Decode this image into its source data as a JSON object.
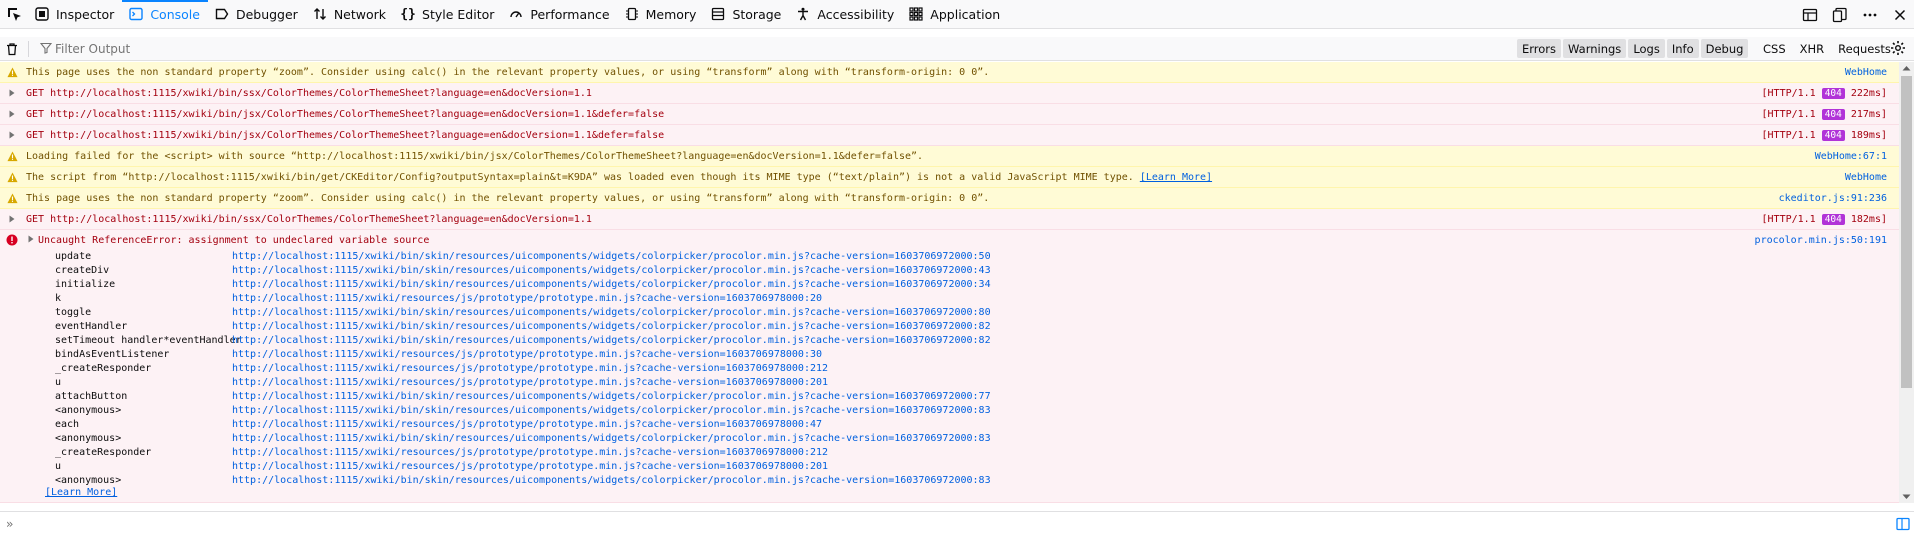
{
  "tabs": [
    {
      "label": "Inspector",
      "icon": "inspector-icon"
    },
    {
      "label": "Console",
      "icon": "console-icon",
      "selected": true
    },
    {
      "label": "Debugger",
      "icon": "debugger-icon"
    },
    {
      "label": "Network",
      "icon": "network-icon"
    },
    {
      "label": "Style Editor",
      "icon": "style-editor-icon"
    },
    {
      "label": "Performance",
      "icon": "performance-icon"
    },
    {
      "label": "Memory",
      "icon": "memory-icon"
    },
    {
      "label": "Storage",
      "icon": "storage-icon"
    },
    {
      "label": "Accessibility",
      "icon": "accessibility-icon"
    },
    {
      "label": "Application",
      "icon": "application-icon"
    }
  ],
  "filter": {
    "placeholder": "Filter Output"
  },
  "levels": [
    "Errors",
    "Warnings",
    "Logs",
    "Info",
    "Debug"
  ],
  "categories": [
    "CSS",
    "XHR",
    "Requests"
  ],
  "colors": {
    "accent": "#0a84ff",
    "warn_bg": "#fffbd6",
    "error_bg": "#fdf2f5",
    "badge": "#b133d8",
    "link": "#0060df"
  },
  "messages": [
    {
      "text": "This page uses the non standard property “zoom”. Consider using calc() in the relevant property values, or using “transform” along with “transform-origin: 0 0”.",
      "source": "WebHome"
    },
    {
      "text": "GET http://localhost:1115/xwiki/bin/ssx/ColorThemes/ColorThemeSheet?language=en&docVersion=1.1",
      "proto": "[HTTP/1.1",
      "status": "404",
      "time": "222ms]"
    },
    {
      "text": "GET http://localhost:1115/xwiki/bin/jsx/ColorThemes/ColorThemeSheet?language=en&docVersion=1.1&defer=false",
      "proto": "[HTTP/1.1",
      "status": "404",
      "time": "217ms]"
    },
    {
      "text": "GET http://localhost:1115/xwiki/bin/jsx/ColorThemes/ColorThemeSheet?language=en&docVersion=1.1&defer=false",
      "proto": "[HTTP/1.1",
      "status": "404",
      "time": "189ms]"
    },
    {
      "text": "Loading failed for the <script> with source “http://localhost:1115/xwiki/bin/jsx/ColorThemes/ColorThemeSheet?language=en&docVersion=1.1&defer=false”.",
      "source": "WebHome:67:1"
    },
    {
      "text": "The script from “http://localhost:1115/xwiki/bin/get/CKEditor/Config?outputSyntax=plain&t=K9DA” was loaded even though its MIME type (“text/plain”) is not a valid JavaScript MIME type.",
      "learn": "[Learn More]",
      "source": "WebHome"
    },
    {
      "text": "This page uses the non standard property “zoom”. Consider using calc() in the relevant property values, or using “transform” along with “transform-origin: 0 0”.",
      "source": "ckeditor.js:91:236"
    },
    {
      "text": "GET http://localhost:1115/xwiki/bin/ssx/ColorThemes/ColorThemeSheet?language=en&docVersion=1.1",
      "proto": "[HTTP/1.1",
      "status": "404",
      "time": "182ms]"
    }
  ],
  "error": {
    "text": "Uncaught ReferenceError: assignment to undeclared variable source",
    "source": "procolor.min.js:50:191",
    "learn": "[Learn More]",
    "frames": [
      {
        "fn": "update",
        "loc": "http://localhost:1115/xwiki/bin/skin/resources/uicomponents/widgets/colorpicker/procolor.min.js?cache-version=1603706972000:50"
      },
      {
        "fn": "createDiv",
        "loc": "http://localhost:1115/xwiki/bin/skin/resources/uicomponents/widgets/colorpicker/procolor.min.js?cache-version=1603706972000:43"
      },
      {
        "fn": "initialize",
        "loc": "http://localhost:1115/xwiki/bin/skin/resources/uicomponents/widgets/colorpicker/procolor.min.js?cache-version=1603706972000:34"
      },
      {
        "fn": "k",
        "loc": "http://localhost:1115/xwiki/resources/js/prototype/prototype.min.js?cache-version=1603706978000:20"
      },
      {
        "fn": "toggle",
        "loc": "http://localhost:1115/xwiki/bin/skin/resources/uicomponents/widgets/colorpicker/procolor.min.js?cache-version=1603706972000:80"
      },
      {
        "fn": "eventHandler",
        "loc": "http://localhost:1115/xwiki/bin/skin/resources/uicomponents/widgets/colorpicker/procolor.min.js?cache-version=1603706972000:82"
      },
      {
        "fn": "setTimeout handler*eventHandler",
        "loc": "http://localhost:1115/xwiki/bin/skin/resources/uicomponents/widgets/colorpicker/procolor.min.js?cache-version=1603706972000:82"
      },
      {
        "fn": "bindAsEventListener",
        "loc": "http://localhost:1115/xwiki/resources/js/prototype/prototype.min.js?cache-version=1603706978000:30"
      },
      {
        "fn": "_createResponder",
        "loc": "http://localhost:1115/xwiki/resources/js/prototype/prototype.min.js?cache-version=1603706978000:212"
      },
      {
        "fn": "u",
        "loc": "http://localhost:1115/xwiki/resources/js/prototype/prototype.min.js?cache-version=1603706978000:201"
      },
      {
        "fn": "attachButton",
        "loc": "http://localhost:1115/xwiki/bin/skin/resources/uicomponents/widgets/colorpicker/procolor.min.js?cache-version=1603706972000:77"
      },
      {
        "fn": "<anonymous>",
        "loc": "http://localhost:1115/xwiki/bin/skin/resources/uicomponents/widgets/colorpicker/procolor.min.js?cache-version=1603706972000:83"
      },
      {
        "fn": "each",
        "loc": "http://localhost:1115/xwiki/resources/js/prototype/prototype.min.js?cache-version=1603706978000:47"
      },
      {
        "fn": "<anonymous>",
        "loc": "http://localhost:1115/xwiki/bin/skin/resources/uicomponents/widgets/colorpicker/procolor.min.js?cache-version=1603706972000:83"
      },
      {
        "fn": "_createResponder",
        "loc": "http://localhost:1115/xwiki/resources/js/prototype/prototype.min.js?cache-version=1603706978000:212"
      },
      {
        "fn": "u",
        "loc": "http://localhost:1115/xwiki/resources/js/prototype/prototype.min.js?cache-version=1603706978000:201"
      },
      {
        "fn": "<anonymous>",
        "loc": "http://localhost:1115/xwiki/bin/skin/resources/uicomponents/widgets/colorpicker/procolor.min.js?cache-version=1603706972000:83"
      }
    ]
  },
  "prompt": "»"
}
